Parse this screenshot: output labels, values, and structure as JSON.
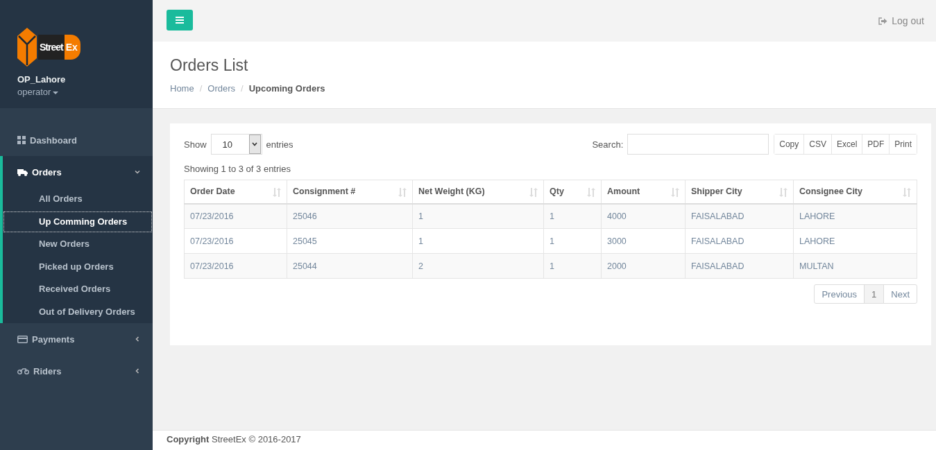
{
  "sidebar": {
    "logo": {
      "text_1": "Street",
      "text_2": "Ex"
    },
    "user": {
      "name": "OP_Lahore",
      "role": "operator"
    },
    "menu": [
      {
        "label": "Dashboard",
        "expanded": false,
        "has_arrow": false
      },
      {
        "label": "Orders",
        "expanded": true,
        "has_arrow": true,
        "children": [
          {
            "label": "All Orders",
            "selected": false
          },
          {
            "label": "Up Comming Orders",
            "selected": true
          },
          {
            "label": "New Orders",
            "selected": false
          },
          {
            "label": "Picked up Orders",
            "selected": false
          },
          {
            "label": "Received Orders",
            "selected": false
          },
          {
            "label": "Out of Delivery Orders",
            "selected": false
          }
        ]
      },
      {
        "label": "Payments",
        "expanded": false,
        "has_arrow": true
      },
      {
        "label": "Riders",
        "expanded": false,
        "has_arrow": true
      }
    ]
  },
  "topbar": {
    "logout": "Log out"
  },
  "page": {
    "title": "Orders List",
    "breadcrumb": [
      "Home",
      "Orders",
      "Upcoming Orders"
    ],
    "breadcrumb_separator": "/"
  },
  "table_controls": {
    "show_label": "Show",
    "page_size": "10",
    "entries_label": "entries",
    "search_label": "Search:",
    "export_buttons": [
      "Copy",
      "CSV",
      "Excel",
      "PDF",
      "Print"
    ],
    "info": "Showing 1 to 3 of 3 entries"
  },
  "table": {
    "columns": [
      "Order Date",
      "Consignment #",
      "Net Weight (KG)",
      "Qty",
      "Amount",
      "Shipper City",
      "Consignee City"
    ],
    "rows": [
      [
        "07/23/2016",
        "25046",
        "1",
        "1",
        "4000",
        "FAISALABAD",
        "LAHORE"
      ],
      [
        "07/23/2016",
        "25045",
        "1",
        "1",
        "3000",
        "FAISALABAD",
        "LAHORE"
      ],
      [
        "07/23/2016",
        "25044",
        "2",
        "1",
        "2000",
        "FAISALABAD",
        "MULTAN"
      ]
    ]
  },
  "pagination": [
    {
      "label": "Previous",
      "selected": false
    },
    {
      "label": "1",
      "selected": true
    },
    {
      "label": "Next",
      "selected": false
    }
  ],
  "footer": "**Copyright** StreetEx © 2016-2017"
}
